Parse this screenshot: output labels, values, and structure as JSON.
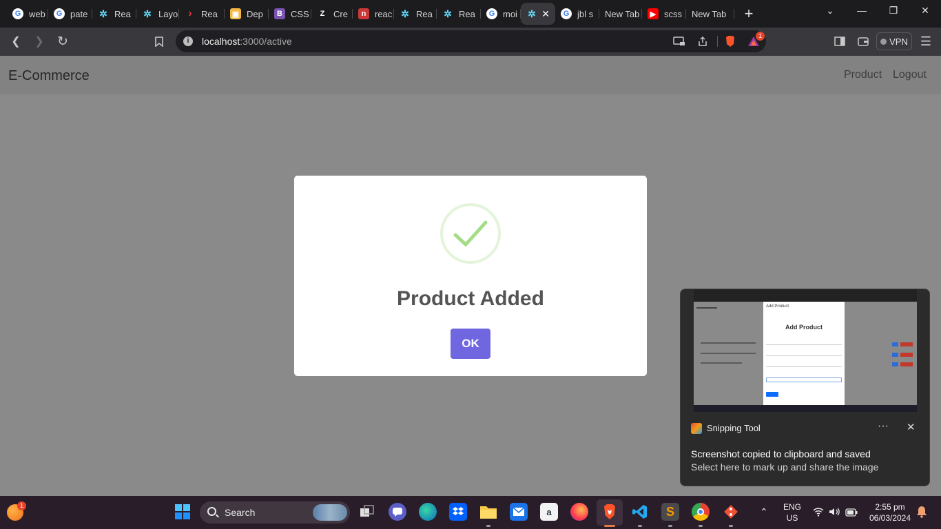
{
  "browser": {
    "tabs": [
      {
        "label": "web",
        "icon": "google-icon",
        "color": "#4285f4"
      },
      {
        "label": "pate",
        "icon": "google-icon",
        "color": "#4285f4"
      },
      {
        "label": "Rea",
        "icon": "react-icon",
        "color": "#61dafb"
      },
      {
        "label": "Layo",
        "icon": "react-icon",
        "color": "#61dafb"
      },
      {
        "label": "Rea",
        "icon": "chevron-icon",
        "color": "#e53935"
      },
      {
        "label": "Dep",
        "icon": "box-icon",
        "color": "#f5b942"
      },
      {
        "label": "CSS",
        "icon": "bootstrap-icon",
        "color": "#7952b3"
      },
      {
        "label": "Cre",
        "icon": "z-icon",
        "color": "#2b2b2b"
      },
      {
        "label": "reac",
        "icon": "npm-icon",
        "color": "#cb3837"
      },
      {
        "label": "Rea",
        "icon": "react-icon",
        "color": "#61dafb"
      },
      {
        "label": "Rea",
        "icon": "react-icon",
        "color": "#61dafb"
      },
      {
        "label": "moi",
        "icon": "google-icon",
        "color": "#4285f4"
      },
      {
        "label": "",
        "icon": "react-icon",
        "color": "#61dafb",
        "active": true
      },
      {
        "label": "jbl s",
        "icon": "google-icon",
        "color": "#4285f4"
      },
      {
        "label": "New Tab",
        "icon": "",
        "color": ""
      },
      {
        "label": "scss",
        "icon": "youtube-icon",
        "color": "#ff0000"
      },
      {
        "label": "New Tab",
        "icon": "",
        "color": ""
      }
    ],
    "url_host": "localhost",
    "url_path": ":3000/active",
    "brave_badge": "1",
    "vpn_label": "VPN"
  },
  "page": {
    "brand": "E-Commerce",
    "nav_links": [
      "Product",
      "Logout"
    ]
  },
  "modal": {
    "title": "Product Added",
    "ok_label": "OK",
    "accent_color": "#7066e0",
    "success_color": "#a5dc86"
  },
  "notification": {
    "app_name": "Snipping Tool",
    "more": "···",
    "title": "Screenshot copied to clipboard and saved",
    "body": "Select here to mark up and share the image",
    "thumbnail_title": "Add Product",
    "thumbnail_header": "Add Product"
  },
  "taskbar": {
    "search_label": "Search",
    "start_badge": "1",
    "language": "ENG",
    "region": "US",
    "time": "2:55 pm",
    "date": "06/03/2024"
  }
}
